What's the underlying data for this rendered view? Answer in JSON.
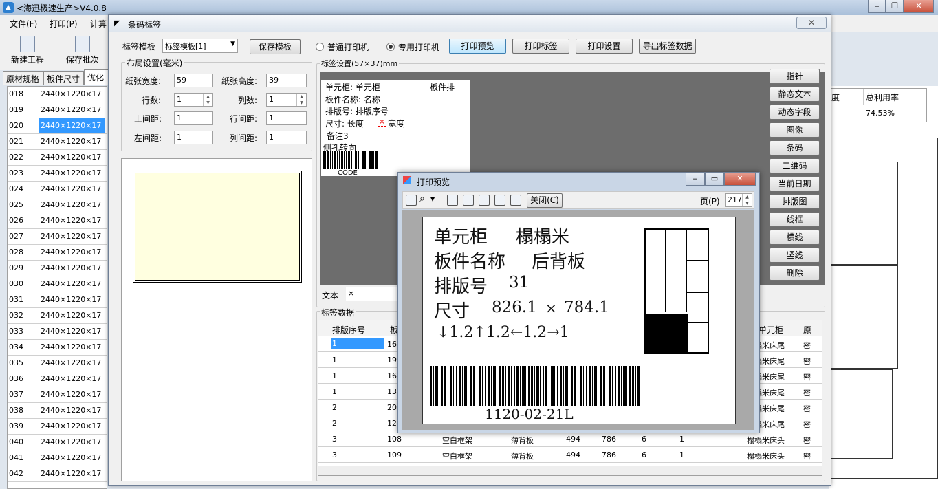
{
  "window": {
    "title": "<海迅极速生产>V4.0.8",
    "min": "‒",
    "max": "❐",
    "close": "✕"
  },
  "menu": [
    "文件(F)",
    "打印(P)",
    "计算"
  ],
  "toolbar": {
    "new_label": "新建工程",
    "save_label": "保存批次"
  },
  "main_tabs": [
    "原材规格",
    "板件尺寸",
    "优化"
  ],
  "left_grid": {
    "rows": [
      {
        "id": "018",
        "size": "2440×1220×17"
      },
      {
        "id": "019",
        "size": "2440×1220×17"
      },
      {
        "id": "020",
        "size": "2440×1220×17"
      },
      {
        "id": "021",
        "size": "2440×1220×17"
      },
      {
        "id": "022",
        "size": "2440×1220×17"
      },
      {
        "id": "023",
        "size": "2440×1220×17"
      },
      {
        "id": "024",
        "size": "2440×1220×17"
      },
      {
        "id": "025",
        "size": "2440×1220×17"
      },
      {
        "id": "026",
        "size": "2440×1220×17"
      },
      {
        "id": "027",
        "size": "2440×1220×17"
      },
      {
        "id": "028",
        "size": "2440×1220×17"
      },
      {
        "id": "029",
        "size": "2440×1220×17"
      },
      {
        "id": "030",
        "size": "2440×1220×17"
      },
      {
        "id": "031",
        "size": "2440×1220×17"
      },
      {
        "id": "032",
        "size": "2440×1220×17"
      },
      {
        "id": "033",
        "size": "2440×1220×17"
      },
      {
        "id": "034",
        "size": "2440×1220×17"
      },
      {
        "id": "035",
        "size": "2440×1220×17"
      },
      {
        "id": "036",
        "size": "2440×1220×17"
      },
      {
        "id": "037",
        "size": "2440×1220×17"
      },
      {
        "id": "038",
        "size": "2440×1220×17"
      },
      {
        "id": "039",
        "size": "2440×1220×17"
      },
      {
        "id": "040",
        "size": "2440×1220×17"
      },
      {
        "id": "041",
        "size": "2440×1220×17"
      },
      {
        "id": "042",
        "size": "2440×1220×17"
      }
    ],
    "selected_id": "020"
  },
  "right_bg": {
    "col_a": "度",
    "col_b": "总利用率",
    "value": "74.53%"
  },
  "dialog": {
    "title": "条码标签",
    "close": "✕",
    "template_label": "标签模板",
    "template_value": "标签模板[1]",
    "save_template": "保存模板",
    "printer_normal": "普通打印机",
    "printer_special": "专用打印机",
    "preview_btn": "打印预览",
    "print_btn": "打印标签",
    "settings_btn": "打印设置",
    "export_btn": "导出标签数据",
    "layout_title": "布局设置(毫米)",
    "paper_width_label": "纸张宽度:",
    "paper_width": "59",
    "paper_height_label": "纸张高度:",
    "paper_height": "39",
    "rows_label": "行数:",
    "rows": "1",
    "cols_label": "列数:",
    "cols": "1",
    "top_margin_label": "上间距:",
    "top_margin": "1",
    "row_gap_label": "行间距:",
    "row_gap": "1",
    "left_margin_label": "左间距:",
    "left_margin": "1",
    "col_gap_label": "列间距:",
    "col_gap": "1",
    "label_settings_title": "标签设置(57×37)mm",
    "text_label": "文本",
    "text_value": "×",
    "data_title": "标签数据",
    "side_buttons": [
      "指针",
      "静态文本",
      "动态字段",
      "图像",
      "条码",
      "二维码",
      "当前日期",
      "排版图",
      "线框",
      "横线",
      "竖线",
      "删除"
    ]
  },
  "label_preview": {
    "l1": "单元柜:  单元柜",
    "l1b": "板件排",
    "l2": "板件名称:  名称",
    "l3": "排版号:  排版序号",
    "l4a": "尺寸:  长度",
    "l4b": "宽度",
    "l5": "备注3",
    "l6": "侧孔转向",
    "code": "CODE"
  },
  "data_table": {
    "headers": [
      "排版序号",
      "板",
      "单元柜",
      "原"
    ],
    "rows": [
      {
        "a": "1",
        "b": "16",
        "c": "",
        "d": "",
        "e": "",
        "f": "",
        "g": "",
        "h": "",
        "i": "榻榻米床尾",
        "j": "密"
      },
      {
        "a": "1",
        "b": "19",
        "c": "",
        "d": "",
        "e": "",
        "f": "",
        "g": "",
        "h": "",
        "i": "榻榻米床尾",
        "j": "密"
      },
      {
        "a": "1",
        "b": "16",
        "c": "",
        "d": "",
        "e": "",
        "f": "",
        "g": "",
        "h": "",
        "i": "榻榻米床尾",
        "j": "密"
      },
      {
        "a": "1",
        "b": "13",
        "c": "",
        "d": "",
        "e": "",
        "f": "",
        "g": "",
        "h": "",
        "i": "榻榻米床尾",
        "j": "密"
      },
      {
        "a": "2",
        "b": "20",
        "c": "",
        "d": "",
        "e": "",
        "f": "",
        "g": "",
        "h": "",
        "i": "榻榻米床尾",
        "j": "密"
      },
      {
        "a": "2",
        "b": "12",
        "c": "",
        "d": "",
        "e": "",
        "f": "",
        "g": "",
        "h": "",
        "i": "榻榻米床尾",
        "j": "密"
      },
      {
        "a": "3",
        "b": "108",
        "c": "空白框架",
        "d": "薄背板",
        "e": "494",
        "f": "786",
        "g": "6",
        "h": "1",
        "i": "榻榻米床头",
        "j": "密"
      },
      {
        "a": "3",
        "b": "109",
        "c": "空白框架",
        "d": "薄背板",
        "e": "494",
        "f": "786",
        "g": "6",
        "h": "1",
        "i": "榻榻米床头",
        "j": "密"
      }
    ]
  },
  "print_preview": {
    "title": "打印预览",
    "close_btn": "关闭(C)",
    "page_label": "页(P)",
    "page_value": "217",
    "line1a": "单元柜",
    "line1b": "榻榻米",
    "line2a": "板件名称",
    "line2b": "后背板",
    "line3a": "排版号",
    "line3b": "31",
    "line4a": "尺寸",
    "line4b": "826.1",
    "line4c": "×",
    "line4d": "784.1",
    "line5": "↓1.2↑1.2←1.2→1",
    "barcode_text": "1120-02-21L"
  }
}
